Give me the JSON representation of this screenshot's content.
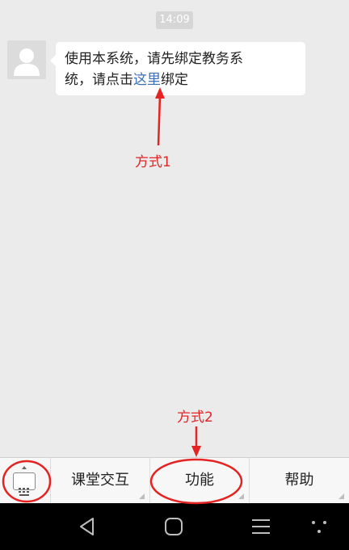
{
  "chat": {
    "timestamp": "14:09",
    "message": {
      "line1": "使用本系统，请先绑定教务系",
      "line2_before": "统，请点击",
      "link_text": "这里",
      "line2_after": "绑定"
    }
  },
  "annotations": {
    "method1": "方式1",
    "method2": "方式2",
    "color": "#e52323"
  },
  "menu": {
    "keyboard_icon": "keyboard-icon",
    "items": [
      {
        "label": "课堂交互"
      },
      {
        "label": "功能"
      },
      {
        "label": "帮助"
      }
    ]
  },
  "navbar": {
    "icons": [
      "back-icon",
      "home-icon",
      "menu-icon",
      "more-icon"
    ]
  }
}
